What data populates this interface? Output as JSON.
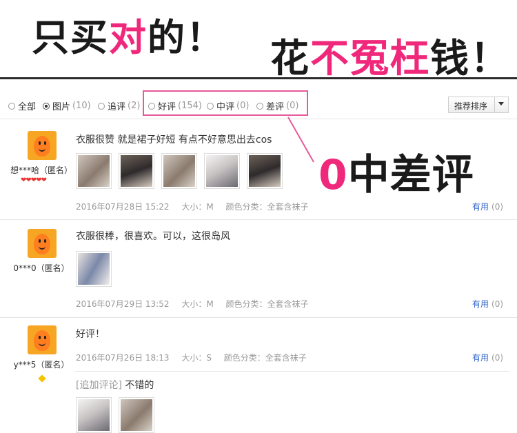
{
  "banner": {
    "left_part1": "只买",
    "left_highlight": "对",
    "left_part2": "的！",
    "right_part1": "花",
    "right_highlight": "不冤枉",
    "right_part2": "钱！",
    "accent_color": "#f0287b"
  },
  "filters": [
    {
      "label": "全部",
      "count": "",
      "checked": false
    },
    {
      "label": "图片",
      "count": "(10)",
      "checked": true
    },
    {
      "label": "追评",
      "count": "(2)",
      "checked": false
    },
    {
      "label": "好评",
      "count": "(154)",
      "checked": false
    },
    {
      "label": "中评",
      "count": "(0)",
      "checked": false
    },
    {
      "label": "差评",
      "count": "(0)",
      "checked": false
    }
  ],
  "sort": {
    "label": "推荐排序"
  },
  "callout": {
    "zero": "0",
    "text": "中差评"
  },
  "reviews": [
    {
      "username": "想***哈（匿名）",
      "hearts": "❤❤❤❤❤",
      "content": "衣服很赞 就是裙子好短 有点不好意思出去cos",
      "date": "2016年07月28日 15:22",
      "size": "大小：M",
      "color": "颜色分类：全套含袜子",
      "useful_label": "有用",
      "useful_count": "(0)"
    },
    {
      "username": "0***0（匿名）",
      "content": "衣服很棒，很喜欢。可以，这很岛风",
      "date": "2016年07月29日 13:52",
      "size": "大小：M",
      "color": "颜色分类：全套含袜子",
      "useful_label": "有用",
      "useful_count": "(0)"
    },
    {
      "username": "y***5（匿名）",
      "content": "好评！",
      "date": "2016年07月26日 18:13",
      "size": "大小：S",
      "color": "颜色分类：全套含袜子",
      "useful_label": "有用",
      "useful_count": "(0)",
      "append_tag": "[追加评论]",
      "append_text": "不错的"
    }
  ]
}
